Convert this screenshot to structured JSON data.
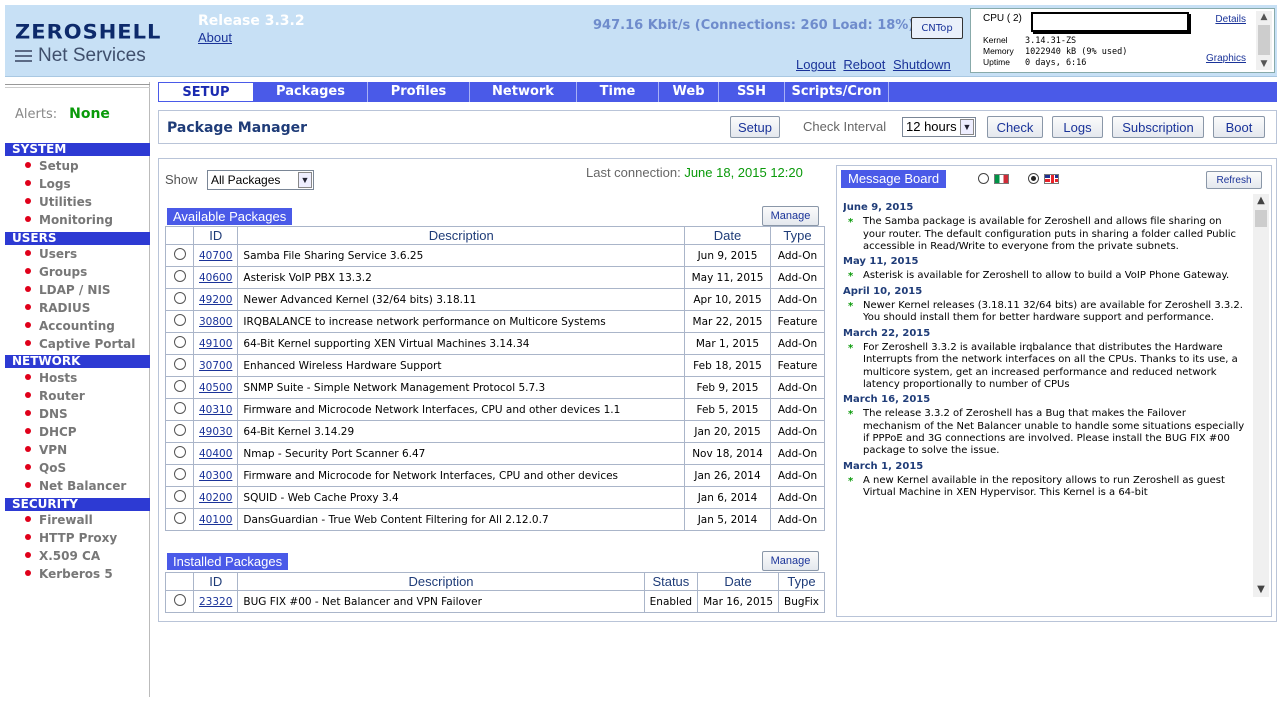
{
  "header": {
    "logo_brand": "ZEROSHELL",
    "logo_tagline": "Net Services",
    "release": "Release 3.3.2",
    "about": "About",
    "stats": "947.16 Kbit/s (Connections: 260 Load: 18%)",
    "cntop": "CNTop",
    "links": [
      "Logout",
      "Reboot",
      "Shutdown"
    ]
  },
  "sysinfo": {
    "cpu_label": "CPU ( 2)",
    "details": "Details",
    "graphics": "Graphics",
    "kernel_label": "Kernel",
    "kernel": "3.14.31-ZS",
    "memory_label": "Memory",
    "memory": "1022940 kB (9% used)",
    "uptime_label": "Uptime",
    "uptime": "0 days, 6:16"
  },
  "alerts": {
    "label": "Alerts:",
    "value": "None"
  },
  "sidebar": {
    "sections": [
      {
        "title": "SYSTEM",
        "items": [
          "Setup",
          "Logs",
          "Utilities",
          "Monitoring"
        ]
      },
      {
        "title": "USERS",
        "items": [
          "Users",
          "Groups",
          "LDAP / NIS",
          "RADIUS",
          "Accounting",
          "Captive Portal"
        ]
      },
      {
        "title": "NETWORK",
        "items": [
          "Hosts",
          "Router",
          "DNS",
          "DHCP",
          "VPN",
          "QoS",
          "Net Balancer"
        ]
      },
      {
        "title": "SECURITY",
        "items": [
          "Firewall",
          "HTTP Proxy",
          "X.509 CA",
          "Kerberos 5"
        ]
      }
    ]
  },
  "menu": [
    "SETUP",
    "Packages",
    "Profiles",
    "Network",
    "Time",
    "Web",
    "SSH",
    "Scripts/Cron"
  ],
  "titlebar": {
    "title": "Package Manager",
    "setup": "Setup",
    "check_interval_label": "Check Interval",
    "check_interval_value": "12 hours",
    "check": "Check",
    "logs": "Logs",
    "subscription": "Subscription",
    "boot": "Boot"
  },
  "filter": {
    "show_label": "Show",
    "show_value": "All Packages",
    "last_connection_label": "Last connection:",
    "last_connection_value": "June 18, 2015 12:20"
  },
  "available": {
    "title": "Available Packages",
    "manage": "Manage",
    "headers": [
      "ID",
      "Description",
      "Date",
      "Type"
    ],
    "rows": [
      [
        "40700",
        "Samba File Sharing Service 3.6.25",
        "Jun 9, 2015",
        "Add-On"
      ],
      [
        "40600",
        "Asterisk VoIP PBX 13.3.2",
        "May 11, 2015",
        "Add-On"
      ],
      [
        "49200",
        "Newer Advanced Kernel (32/64 bits) 3.18.11",
        "Apr 10, 2015",
        "Add-On"
      ],
      [
        "30800",
        "IRQBALANCE to increase network performance on Multicore Systems",
        "Mar 22, 2015",
        "Feature"
      ],
      [
        "49100",
        "64-Bit Kernel supporting XEN Virtual Machines 3.14.34",
        "Mar 1, 2015",
        "Add-On"
      ],
      [
        "30700",
        "Enhanced Wireless Hardware Support",
        "Feb 18, 2015",
        "Feature"
      ],
      [
        "40500",
        "SNMP Suite - Simple Network Management Protocol 5.7.3",
        "Feb 9, 2015",
        "Add-On"
      ],
      [
        "40310",
        "Firmware and Microcode Network Interfaces, CPU and other devices 1.1",
        "Feb 5, 2015",
        "Add-On"
      ],
      [
        "49030",
        "64-Bit Kernel 3.14.29",
        "Jan 20, 2015",
        "Add-On"
      ],
      [
        "40400",
        "Nmap - Security Port Scanner 6.47",
        "Nov 18, 2014",
        "Add-On"
      ],
      [
        "40300",
        "Firmware and Microcode for Network Interfaces, CPU and other devices",
        "Jan 26, 2014",
        "Add-On"
      ],
      [
        "40200",
        "SQUID - Web Cache Proxy 3.4",
        "Jan 6, 2014",
        "Add-On"
      ],
      [
        "40100",
        "DansGuardian - True Web Content Filtering for All 2.12.0.7",
        "Jan 5, 2014",
        "Add-On"
      ]
    ]
  },
  "installed": {
    "title": "Installed Packages",
    "manage": "Manage",
    "headers": [
      "ID",
      "Description",
      "Status",
      "Date",
      "Type"
    ],
    "rows": [
      [
        "23320",
        "BUG FIX #00 - Net Balancer and VPN Failover",
        "Enabled",
        "Mar 16, 2015",
        "BugFix"
      ]
    ]
  },
  "message_board": {
    "title": "Message Board",
    "refresh": "Refresh",
    "entries": [
      {
        "date": "June 9, 2015",
        "text": "The Samba package is available for Zeroshell and allows file sharing on your router. The default configuration puts in sharing a folder called Public accessible in Read/Write to everyone from the private subnets."
      },
      {
        "date": "May 11, 2015",
        "text": "Asterisk is available for Zeroshell to allow to build a VoIP Phone Gateway."
      },
      {
        "date": "April 10, 2015",
        "text": "Newer Kernel releases (3.18.11 32/64 bits) are available for Zeroshell 3.3.2. You should install them for better hardware support and performance."
      },
      {
        "date": "March 22, 2015",
        "text": "For Zeroshell 3.3.2 is available irqbalance that distributes the Hardware Interrupts from the network interfaces on all the CPUs. Thanks to its use, a multicore system, get an increased performance and reduced network latency proportionally to number of CPUs"
      },
      {
        "date": "March 16, 2015",
        "text": "The release 3.3.2 of Zeroshell has a Bug that makes the Failover mechanism of the Net Balancer unable to handle some situations especially if PPPoE and 3G connections are involved. Please install the BUG FIX #00 package to solve the issue."
      },
      {
        "date": "March 1, 2015",
        "text": "A new Kernel available in the repository allows to run Zeroshell as guest Virtual Machine in XEN Hypervisor. This Kernel is a 64-bit"
      }
    ]
  },
  "colors": {
    "header_bg": "#c7e0f5",
    "menu_bg": "#4a5ae8",
    "section_bg": "#2d3ad3",
    "accent_green": "#0a9a0a",
    "bullet_red": "#e0001a"
  }
}
